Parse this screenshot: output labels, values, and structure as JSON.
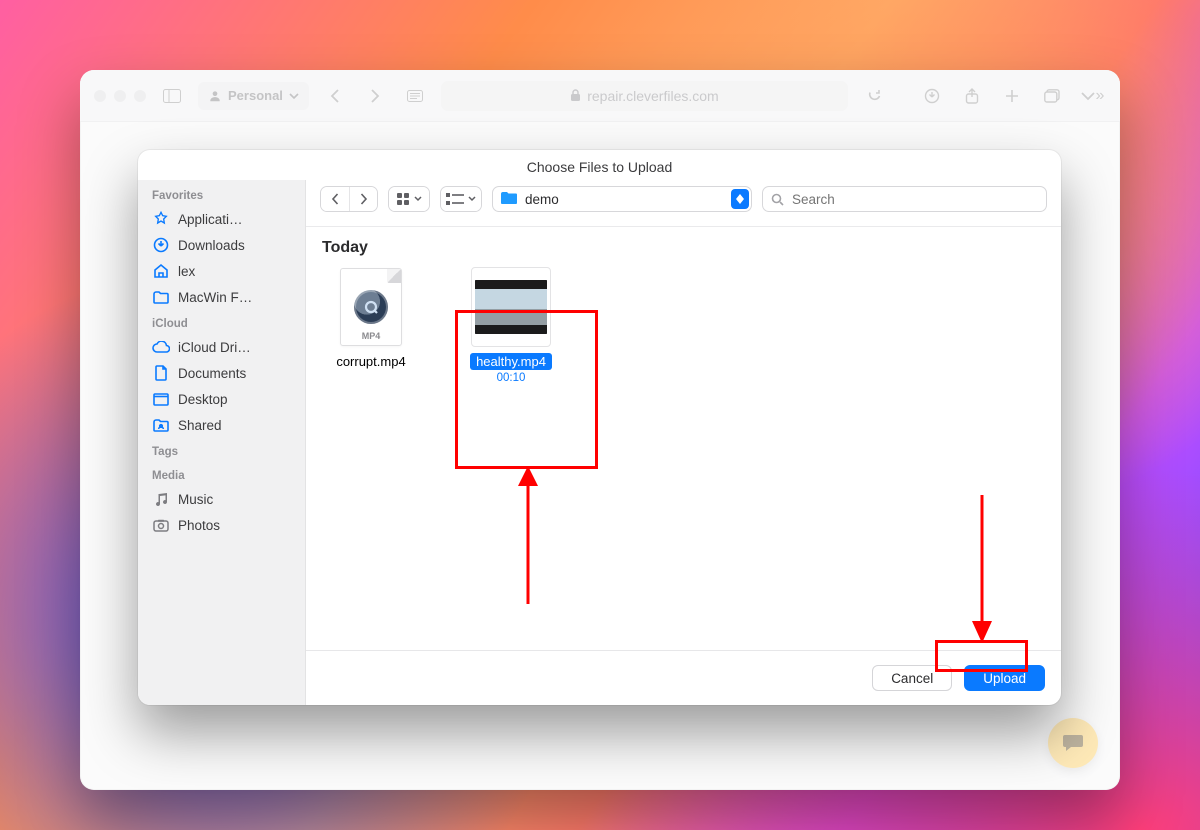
{
  "browser": {
    "profile_label": "Personal",
    "url_host": "repair.cleverfiles.com"
  },
  "dialog": {
    "title": "Choose Files to Upload",
    "current_folder": "demo",
    "search_placeholder": "Search",
    "section_label": "Today",
    "cancel_label": "Cancel",
    "upload_label": "Upload"
  },
  "sidebar": {
    "headers": {
      "favorites": "Favorites",
      "icloud": "iCloud",
      "tags": "Tags",
      "media": "Media"
    },
    "favorites": [
      {
        "icon": "applications",
        "label": "Applicati…"
      },
      {
        "icon": "downloads",
        "label": "Downloads"
      },
      {
        "icon": "home",
        "label": "lex"
      },
      {
        "icon": "folder",
        "label": "MacWin F…"
      }
    ],
    "icloud": [
      {
        "icon": "cloud",
        "label": "iCloud Dri…"
      },
      {
        "icon": "doc",
        "label": "Documents"
      },
      {
        "icon": "desktop",
        "label": "Desktop"
      },
      {
        "icon": "shared",
        "label": "Shared"
      }
    ],
    "media": [
      {
        "icon": "music",
        "label": "Music"
      },
      {
        "icon": "photos",
        "label": "Photos"
      }
    ]
  },
  "files": [
    {
      "name": "corrupt.mp4",
      "kind": "document",
      "badge": "MP4",
      "selected": false
    },
    {
      "name": "healthy.mp4",
      "kind": "video",
      "duration": "00:10",
      "selected": true
    }
  ]
}
